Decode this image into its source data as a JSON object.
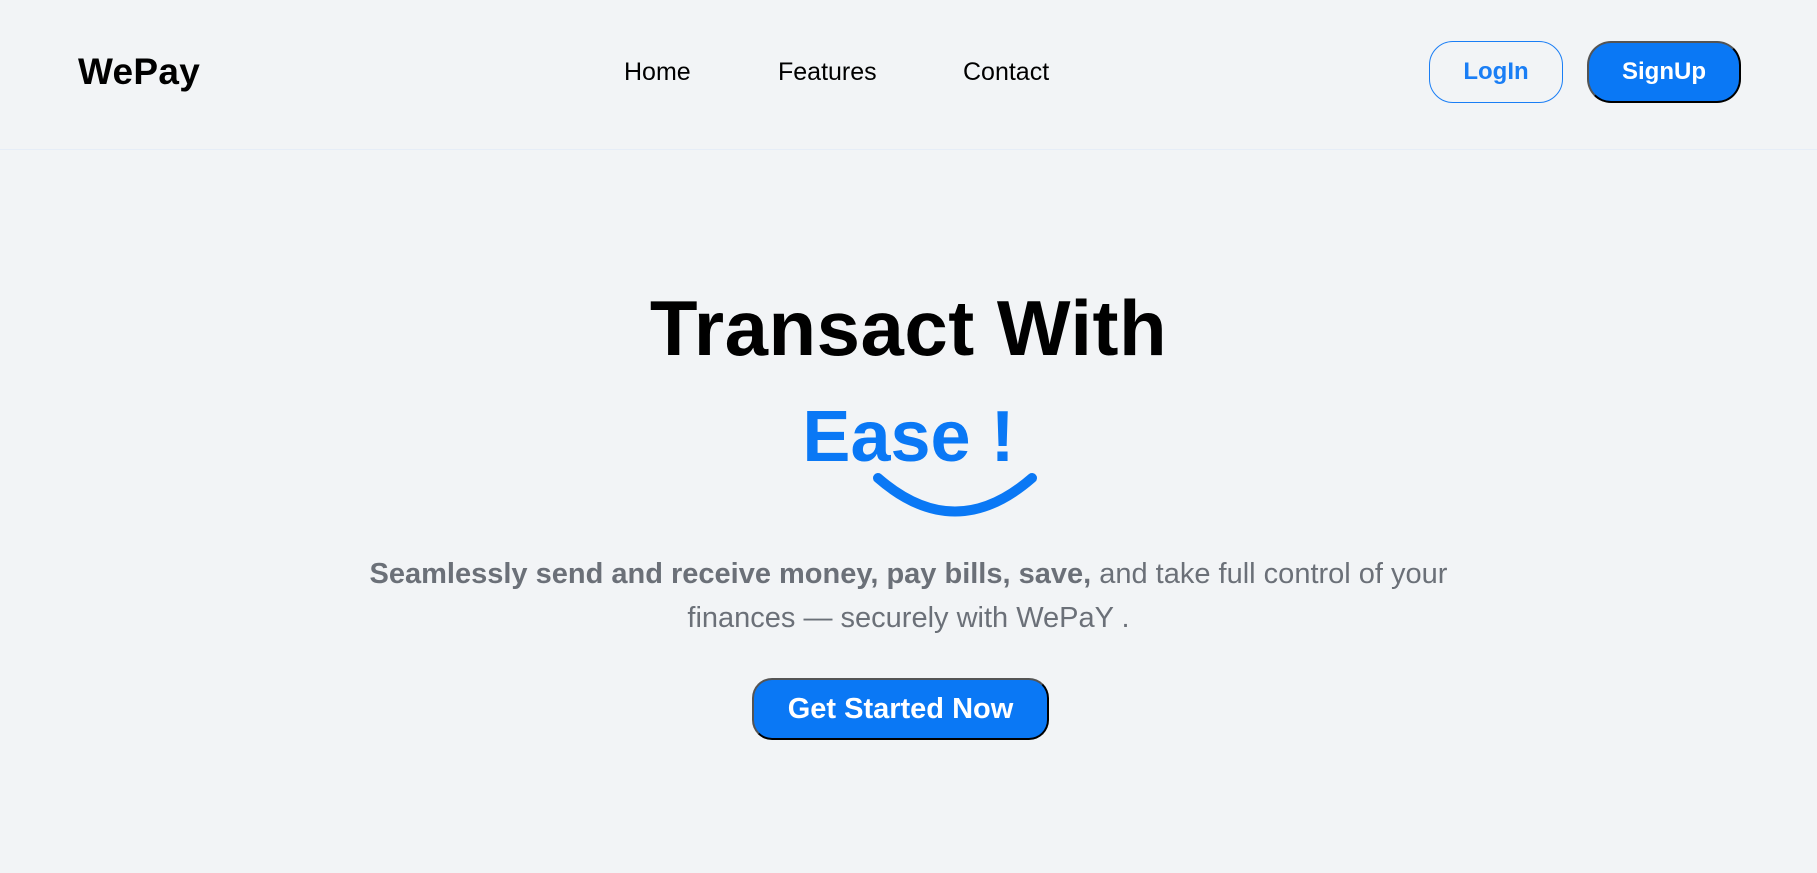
{
  "nav": {
    "brand": "WePay",
    "links": [
      "Home",
      "Features",
      "Contact"
    ],
    "login_label": "LogIn",
    "signup_label": "SignUp"
  },
  "hero": {
    "title": "Transact With",
    "accent": "Ease !",
    "subtitle_bold": "Seamlessly send and receive money, pay bills, save,",
    "subtitle_rest": " and take full control of your finances — securely with WePaY .",
    "cta_label": "Get Started Now"
  },
  "colors": {
    "background": "#f2f4f6",
    "accent": "#0a78f5",
    "text": "#000000",
    "muted_text": "#6b7078"
  },
  "icons": {
    "smile": "smile-curve-icon"
  }
}
